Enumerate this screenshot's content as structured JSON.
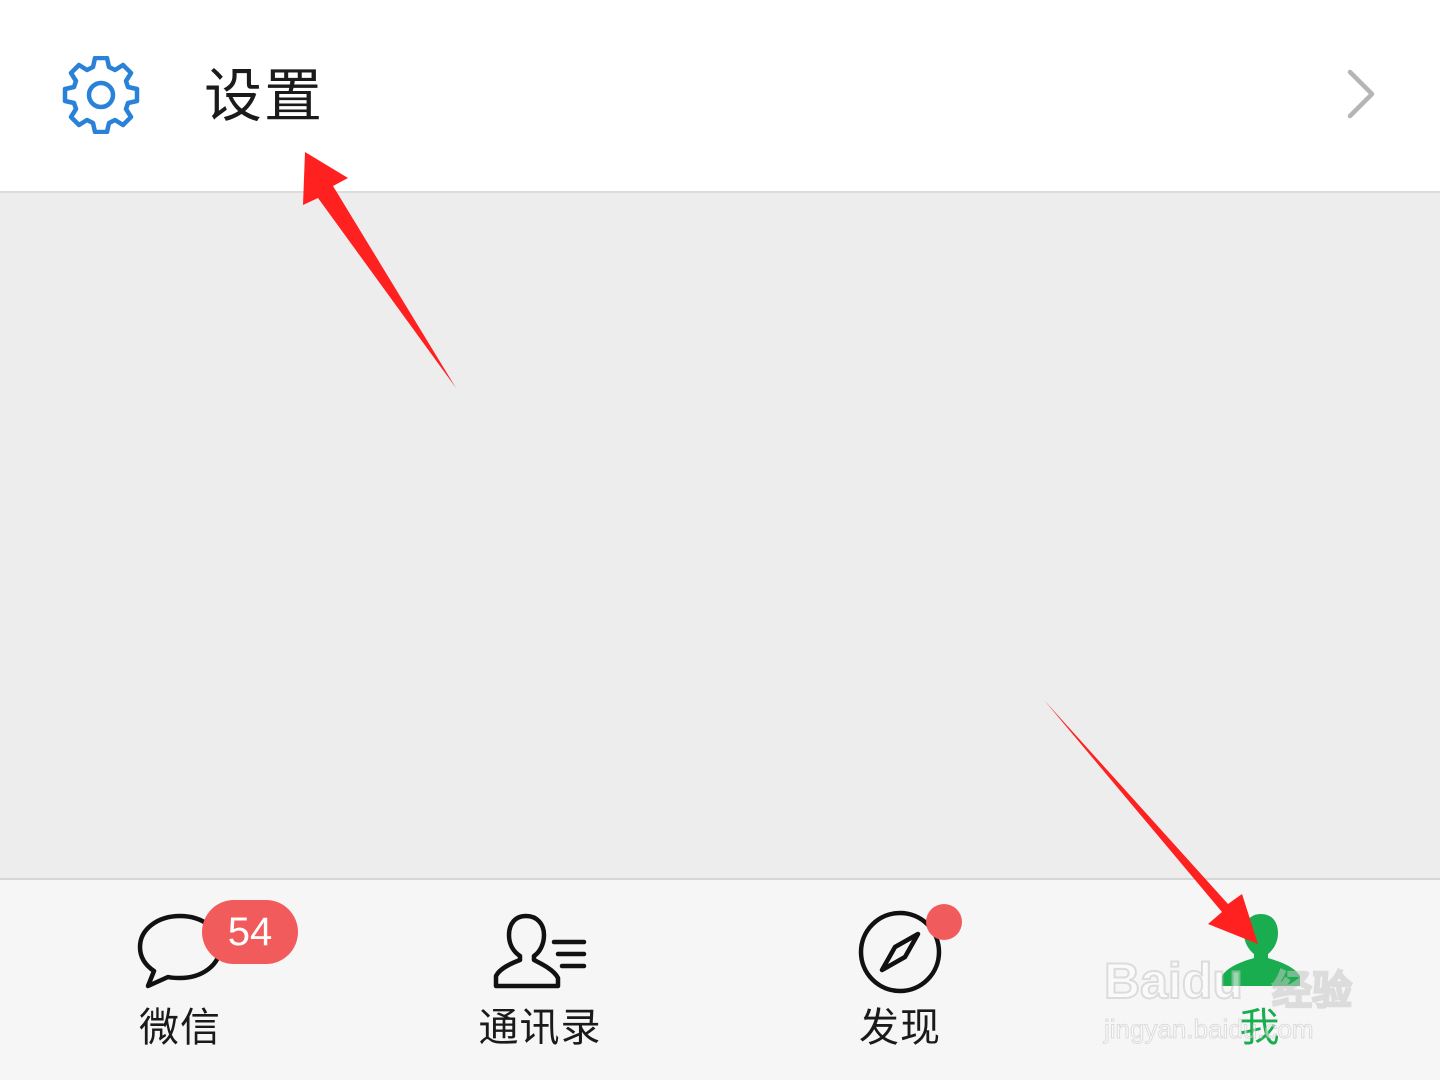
{
  "settings": {
    "label": "设置",
    "icon": "gear-icon",
    "chevron_icon": "chevron-right-icon",
    "icon_color": "#2a82d8"
  },
  "tabbar": {
    "tabs": [
      {
        "label": "微信",
        "icon": "chat-bubbles-icon",
        "badge": "54",
        "active": false
      },
      {
        "label": "通讯录",
        "icon": "contacts-icon",
        "active": false
      },
      {
        "label": "发现",
        "icon": "compass-icon",
        "dot": true,
        "active": false
      },
      {
        "label": "我",
        "icon": "person-icon",
        "active": true
      }
    ],
    "active_color": "#1aad4f",
    "badge_color": "#f25b5b"
  },
  "watermark": {
    "brand": "Baidu",
    "cn": "经验",
    "url": "jingyan.baidu.com"
  }
}
